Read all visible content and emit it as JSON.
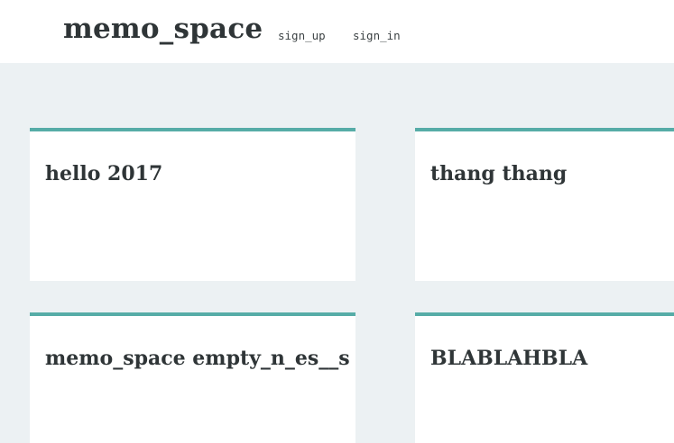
{
  "header": {
    "brand": "memo_space",
    "nav": {
      "sign_up": "sign_up",
      "sign_in": "sign_in"
    }
  },
  "memos": [
    {
      "title": "hello 2017"
    },
    {
      "title": "thang thang"
    },
    {
      "title": "memo_space empty_n_es__s"
    },
    {
      "title": "BLABLAHBLA"
    }
  ],
  "colors": {
    "page_background": "#ecf1f3",
    "header_background": "#ffffff",
    "card_background": "#ffffff",
    "card_accent": "#56aca7",
    "text": "#2f3537"
  }
}
